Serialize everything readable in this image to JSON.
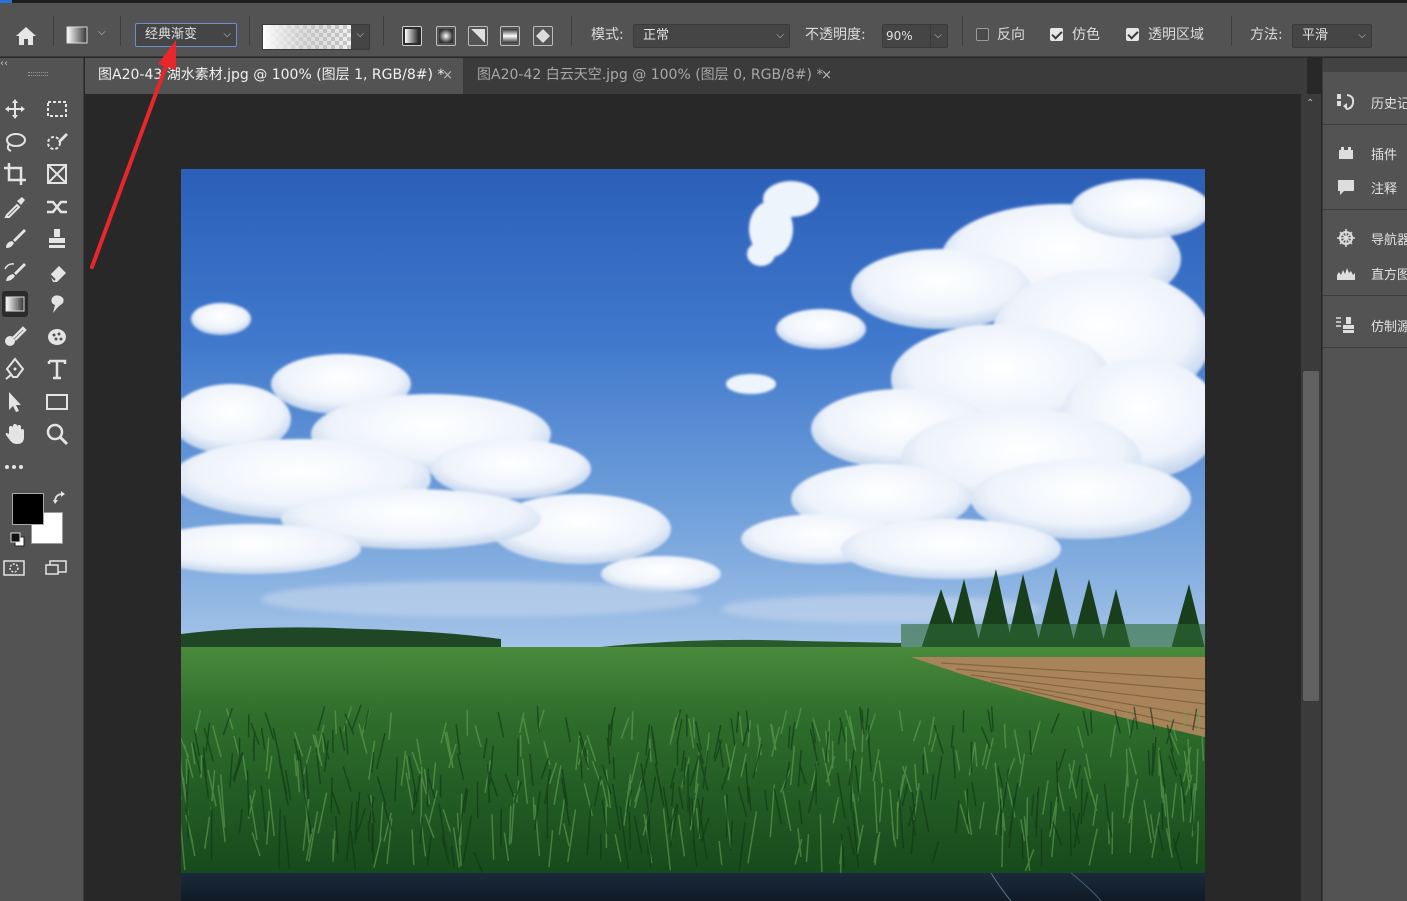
{
  "options_bar": {
    "preset_label": "经典渐变",
    "mode_label": "模式:",
    "mode_value": "正常",
    "opacity_label": "不透明度:",
    "opacity_value": "90%",
    "reverse_label": "反向",
    "dither_label": "仿色",
    "transparency_label": "透明区域",
    "method_label": "方法:",
    "method_value": "平滑",
    "reverse_checked": false,
    "dither_checked": true,
    "transparency_checked": true
  },
  "tabs": [
    {
      "label": "图A20-43 湖水素材.jpg @ 100% (图层 1, RGB/8#) *",
      "active": true
    },
    {
      "label": "图A20-42 白云天空.jpg @ 100% (图层 0, RGB/8#) *",
      "active": false
    }
  ],
  "toolbar": {
    "active_tool": "gradient-tool",
    "foreground_color": "#000000",
    "background_color": "#ffffff"
  },
  "right_panel": {
    "items": [
      {
        "label": "历史记录",
        "icon": "history-icon"
      },
      {
        "label": "插件",
        "icon": "plugins-icon"
      },
      {
        "label": "注释",
        "icon": "notes-icon"
      },
      {
        "label": "导航器",
        "icon": "navigator-icon"
      },
      {
        "label": "直方图",
        "icon": "histogram-icon"
      },
      {
        "label": "仿制源",
        "icon": "clone-source-icon"
      }
    ]
  },
  "annotation": {
    "color": "#e8262b",
    "target": "preset-dropdown"
  }
}
